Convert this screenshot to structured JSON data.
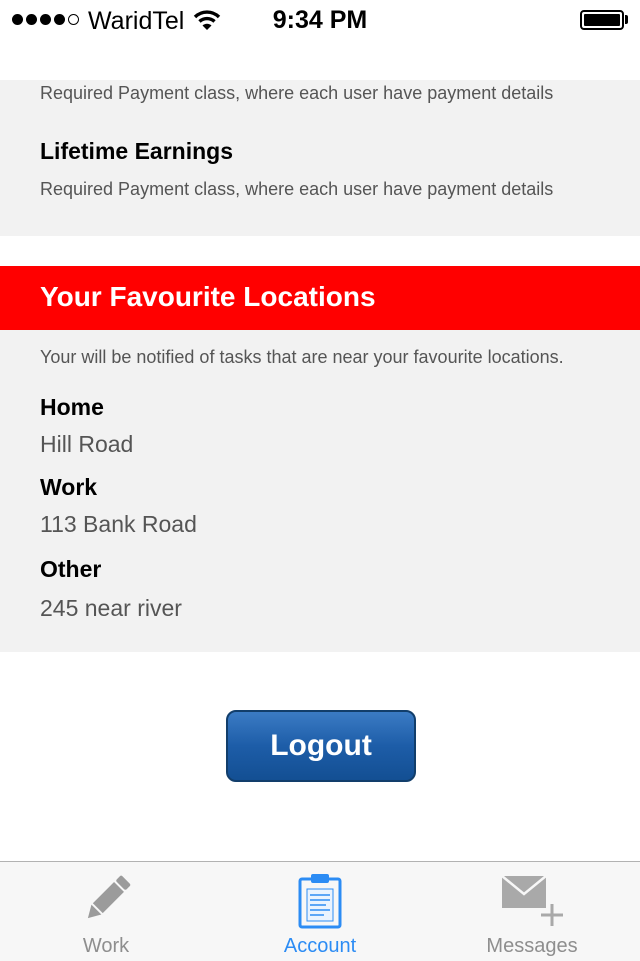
{
  "status_bar": {
    "carrier": "WaridTel",
    "time": "9:34 PM",
    "signal_bars_filled": 4,
    "signal_bars_total": 5
  },
  "payment": {
    "top_description": "Required Payment class, where each user have payment details",
    "lifetime_heading": "Lifetime Earnings",
    "lifetime_description": "Required Payment class, where each user have payment details"
  },
  "favourites": {
    "title": "Your Favourite Locations",
    "description": "Your will be notified of tasks that are near your favourite locations.",
    "locations": [
      {
        "label": "Home",
        "value": "Hill Road"
      },
      {
        "label": "Work",
        "value": "113 Bank Road"
      },
      {
        "label": "Other",
        "value": "245 near river"
      }
    ]
  },
  "logout_label": "Logout",
  "tabs": [
    {
      "label": "Work",
      "icon": "pencil-icon",
      "active": false
    },
    {
      "label": "Account",
      "icon": "clipboard-icon",
      "active": true
    },
    {
      "label": "Messages",
      "icon": "mail-add-icon",
      "active": false
    }
  ],
  "colors": {
    "banner": "#ff0000",
    "active_tab": "#2c8cf4",
    "inactive_tab": "#8e8e8e",
    "button": "#1d5da8"
  }
}
